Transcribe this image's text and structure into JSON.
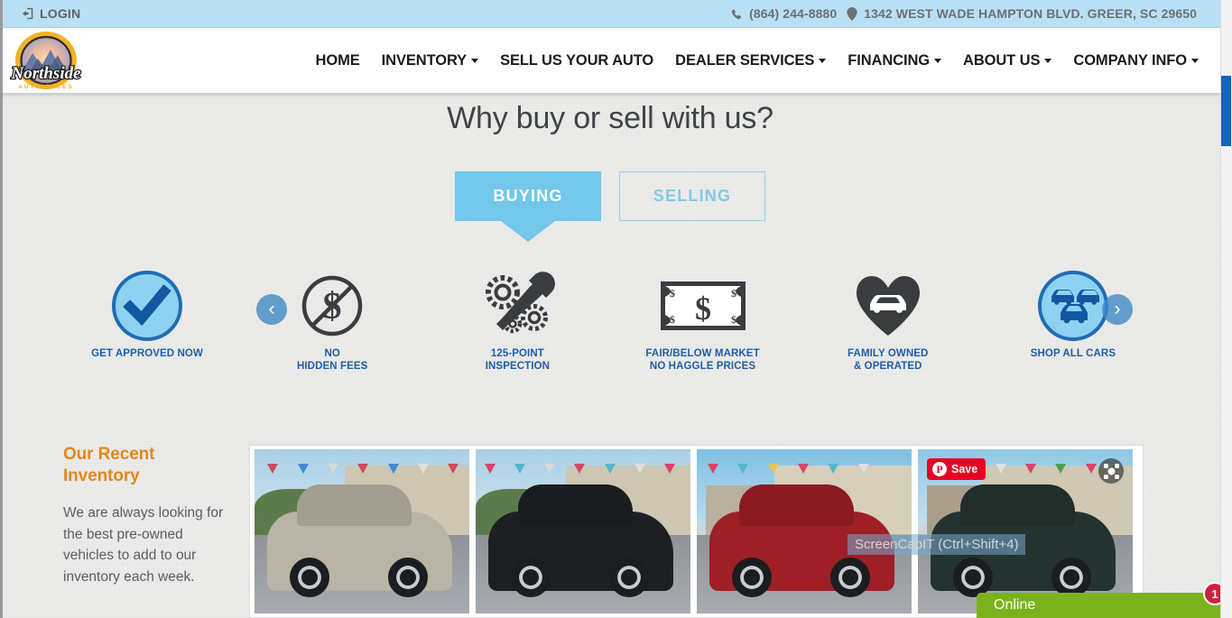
{
  "topbar": {
    "login_label": "LOGIN",
    "login_icon": "sign-in-icon",
    "phone_icon": "phone-icon",
    "phone": "(864) 244-8880",
    "address_icon": "map-marker-icon",
    "address": "1342 WEST WADE HAMPTON BLVD. GREER, SC 29650",
    "bg_color": "#b9e0f5",
    "text_color": "#6a7074"
  },
  "header": {
    "logo_alt": "Northside Auto Sales",
    "nav": [
      {
        "label": "HOME",
        "has_caret": false
      },
      {
        "label": "INVENTORY",
        "has_caret": true
      },
      {
        "label": "SELL US YOUR AUTO",
        "has_caret": false
      },
      {
        "label": "DEALER SERVICES",
        "has_caret": true
      },
      {
        "label": "FINANCING",
        "has_caret": true
      },
      {
        "label": "ABOUT US",
        "has_caret": true
      },
      {
        "label": "COMPANY INFO",
        "has_caret": true
      }
    ]
  },
  "why": {
    "title": "Why buy or sell with us?",
    "tabs": [
      {
        "label": "BUYING",
        "active": true
      },
      {
        "label": "SELLING",
        "active": false
      }
    ],
    "accent_color": "#72c7ea"
  },
  "features": [
    {
      "icon": "checkmark-circle-icon",
      "lines": [
        "GET APPROVED NOW"
      ]
    },
    {
      "icon": "no-dollar-icon",
      "lines": [
        "NO",
        "HIDDEN FEES"
      ]
    },
    {
      "icon": "gears-wrench-icon",
      "lines": [
        "125-POINT",
        "INSPECTION"
      ]
    },
    {
      "icon": "dollar-bill-icon",
      "lines": [
        "FAIR/BELOW MARKET",
        "NO HAGGLE PRICES"
      ]
    },
    {
      "icon": "heart-car-icon",
      "lines": [
        "FAMILY OWNED",
        "& OPERATED"
      ]
    },
    {
      "icon": "three-cars-circle-icon",
      "lines": [
        "SHOP ALL CARS"
      ]
    }
  ],
  "feature_label_color": "#1f5fa8",
  "inventory": {
    "title": "Our Recent Inventory",
    "title_color": "#e3881b",
    "body": "We are always looking for the best pre-owned vehicles to add to our inventory each week.",
    "prev_label": "‹",
    "next_label": "›",
    "cards": [
      {
        "name": "silver-gmc-terrain-suv",
        "body_color": "#b9b4a6",
        "roof_color": "#cac5b8"
      },
      {
        "name": "black-mazda-cx9-suv",
        "body_color": "#1d2023",
        "roof_color": "#2b2f33"
      },
      {
        "name": "red-toyota-highlander-suv",
        "body_color": "#9e1f26",
        "roof_color": "#b02830"
      },
      {
        "name": "dark-green-toyota-rav4-suv",
        "body_color": "#24332f",
        "roof_color": "#30413c"
      }
    ]
  },
  "pinterest": {
    "save_label": "Save",
    "icon": "pinterest-icon",
    "glyph": "P",
    "color": "#e60023"
  },
  "expand_icon": "expand-fullscreen-icon",
  "screencap": {
    "app": "ScreenCapIT",
    "shortcut": "(Ctrl+Shift+4)"
  },
  "chat": {
    "status_label": "Online",
    "badge_count": "1",
    "bg_color": "#7cb31d",
    "badge_color": "#d0203f"
  },
  "scrollbar": {
    "thumb_color": "#1565c0"
  }
}
